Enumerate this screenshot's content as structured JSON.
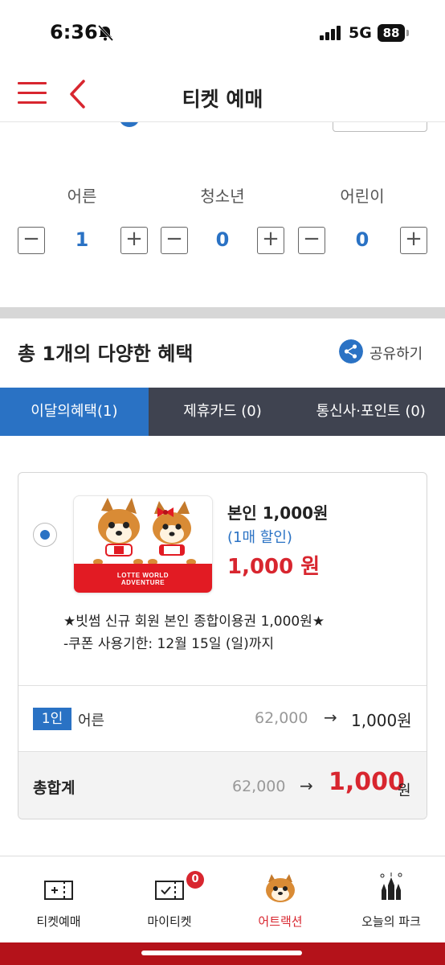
{
  "status": {
    "time": "6:36",
    "network": "5G",
    "battery": "88"
  },
  "header": {
    "title": "티켓 예매"
  },
  "counters": [
    {
      "label": "어른",
      "value": "1",
      "minus": "−",
      "plus": "+"
    },
    {
      "label": "청소년",
      "value": "0",
      "minus": "−",
      "plus": "+"
    },
    {
      "label": "어린이",
      "value": "0",
      "minus": "−",
      "plus": "+"
    }
  ],
  "benefits": {
    "title": "총 1개의 다양한 혜택",
    "share_label": "공유하기",
    "tabs": [
      "이달의혜택(1)",
      "제휴카드 (0)",
      "통신사·포인트 (0)"
    ],
    "active_tab": 0
  },
  "coupon": {
    "logo_text_line1": "LOTTE WORLD",
    "logo_text_line2": "ADVENTURE",
    "title": "본인 1,000원",
    "subtitle": "(1매 할인)",
    "price": "1,000 원",
    "desc1": "★빗썸 신규 회원 본인 종합이용권 1,000원★",
    "desc2": "-쿠폰 사용기한: 12월 15일 (일)까지",
    "person_badge": "1인",
    "person_type": "어른",
    "orig_price": "62,000",
    "arrow": "→",
    "new_price": "1,000원",
    "total_label": "총합계",
    "total_orig": "62,000",
    "total_new": "1,000",
    "total_unit": "원"
  },
  "bottom_nav": [
    {
      "label": "티켓예매",
      "icon": "ticket-icon"
    },
    {
      "label": "마이티켓",
      "icon": "my-ticket-icon",
      "badge": "0"
    },
    {
      "label": "어트랙션",
      "icon": "mascot-icon",
      "active": true
    },
    {
      "label": "오늘의 파크",
      "icon": "castle-icon"
    }
  ],
  "colors": {
    "accent_red": "#d8262f",
    "accent_blue": "#2a72c4",
    "tab_dark": "#3f4350"
  }
}
